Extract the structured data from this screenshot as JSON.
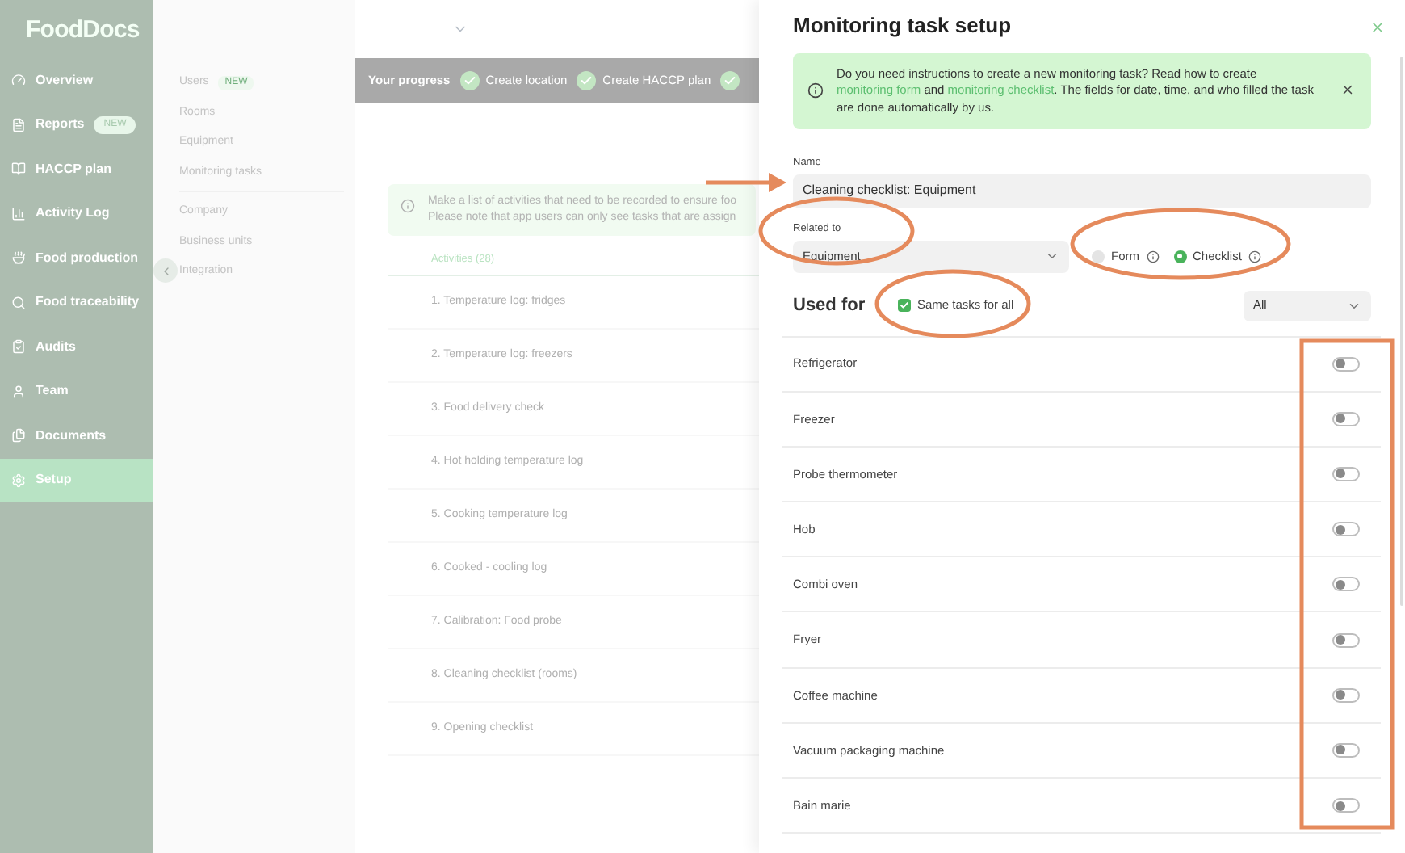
{
  "sidebar": {
    "logo": "FoodDocs",
    "items": [
      {
        "label": "Overview",
        "selected": false
      },
      {
        "label": "Reports",
        "badge": "NEW",
        "selected": false
      },
      {
        "label": "HACCP plan",
        "selected": false
      },
      {
        "label": "Activity Log",
        "selected": false
      },
      {
        "label": "Food production",
        "selected": false
      },
      {
        "label": "Food traceability",
        "selected": false
      },
      {
        "label": "Audits",
        "selected": false
      },
      {
        "label": "Team",
        "selected": false
      },
      {
        "label": "Documents",
        "selected": false
      },
      {
        "label": "Setup",
        "selected": true
      }
    ]
  },
  "submenu": {
    "groups": [
      [
        {
          "label": "Users",
          "badge": "NEW"
        },
        {
          "label": "Rooms"
        },
        {
          "label": "Equipment"
        },
        {
          "label": "Monitoring tasks"
        }
      ],
      [
        {
          "label": "Company"
        },
        {
          "label": "Business units"
        },
        {
          "label": "Integration"
        }
      ]
    ]
  },
  "progress": {
    "title": "Your progress",
    "steps": [
      {
        "label": "Create location",
        "done": true
      },
      {
        "label": "Create HACCP plan",
        "done": true
      },
      {
        "done": true
      }
    ]
  },
  "page_notice": {
    "lines": [
      "Make a list of activities that need to be recorded to ensure foo",
      "Please note that app users can only see tasks that are assign"
    ]
  },
  "activities": {
    "header": "Activities (28)",
    "rows": [
      "1. Temperature log: fridges",
      "2. Temperature log: freezers",
      "3. Food delivery check",
      "4. Hot holding temperature log",
      "5. Cooking temperature log",
      "6. Cooked - cooling log",
      "7. Calibration: Food probe",
      "8. Cleaning checklist (rooms)",
      "9. Opening checklist"
    ]
  },
  "drawer": {
    "title": "Monitoring task setup",
    "notice": [
      {
        "kind": "text",
        "text": "Do you need instructions to create a new monitoring task? Read how to create "
      },
      {
        "kind": "link",
        "text": "monitoring form"
      },
      {
        "kind": "text",
        "text": " and "
      },
      {
        "kind": "link",
        "text": "monitoring checklist"
      },
      {
        "kind": "text",
        "text": ". The fields for date, time, and who filled the task are done automatically by us."
      }
    ],
    "name": {
      "label": "Name",
      "value": "Cleaning checklist: Equipment"
    },
    "related_to": {
      "label": "Related to",
      "value": "Equipment"
    },
    "type_options": [
      {
        "label": "Form",
        "selected": false
      },
      {
        "label": "Checklist",
        "selected": true
      }
    ],
    "used_for": {
      "title": "Used for",
      "same_tasks": {
        "label": "Same tasks for all",
        "checked": true
      },
      "filter": "All"
    },
    "equipment": [
      {
        "name": "Refrigerator",
        "on": false
      },
      {
        "name": "Freezer",
        "on": false
      },
      {
        "name": "Probe thermometer",
        "on": false
      },
      {
        "name": "Hob",
        "on": false
      },
      {
        "name": "Combi oven",
        "on": false
      },
      {
        "name": "Fryer",
        "on": false
      },
      {
        "name": "Coffee machine",
        "on": false
      },
      {
        "name": "Vacuum packaging machine",
        "on": false
      },
      {
        "name": "Bain marie",
        "on": false
      }
    ]
  }
}
